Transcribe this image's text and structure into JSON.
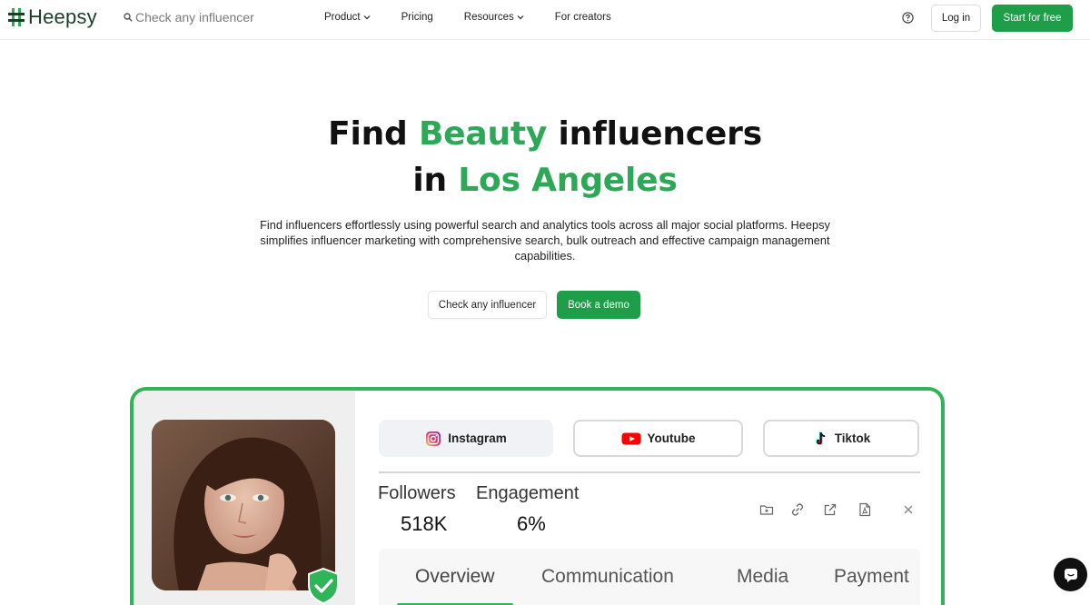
{
  "nav": {
    "logo_text": "Heepsy",
    "search_placeholder": "Check any influencer",
    "links": {
      "product": "Product",
      "pricing": "Pricing",
      "resources": "Resources",
      "creators": "For creators"
    },
    "login": "Log in",
    "start": "Start for free"
  },
  "hero": {
    "title_part1": "Find ",
    "title_accent1": "Beauty",
    "title_part2": " influencers",
    "title_part3": "in ",
    "title_accent2": "Los Angeles",
    "subtitle": "Find influencers effortlessly using powerful search and analytics tools across all major social platforms. Heepsy simplifies influencer marketing with comprehensive search, bulk outreach and effective campaign management capabilities.",
    "btn_check": "Check any influencer",
    "btn_demo": "Book a demo"
  },
  "card": {
    "platforms": {
      "instagram": "Instagram",
      "youtube": "Youtube",
      "tiktok": "Tiktok"
    },
    "stats": {
      "followers_label": "Followers",
      "followers_value": "518K",
      "engagement_label": "Engagement",
      "engagement_value": "6%"
    },
    "tabs": {
      "overview": "Overview",
      "communication": "Communication",
      "media": "Media",
      "payment": "Payment"
    }
  },
  "colors": {
    "brand_green": "#1e9e48",
    "accent_green": "#2da856",
    "card_border": "#2fb457"
  },
  "icons": [
    "search-icon",
    "chevron-down-icon",
    "help-icon",
    "instagram-icon",
    "youtube-icon",
    "tiktok-icon",
    "folder-icon",
    "link-icon",
    "external-link-icon",
    "pdf-icon",
    "close-icon",
    "verified-shield-icon",
    "chat-icon"
  ]
}
